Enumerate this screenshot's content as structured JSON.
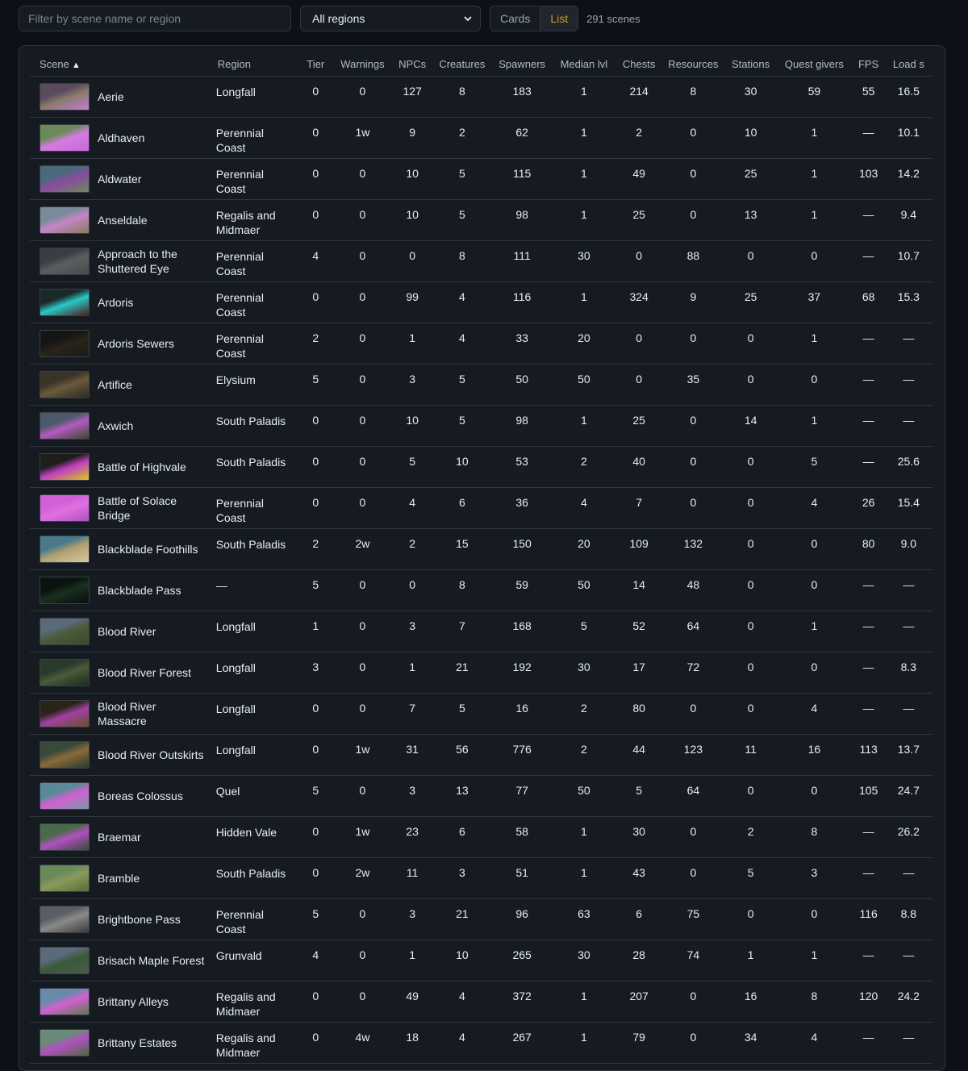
{
  "toolbar": {
    "filter_placeholder": "Filter by scene name or region",
    "region_select": "All regions",
    "view_cards": "Cards",
    "view_list": "List",
    "scene_count": "291 scenes"
  },
  "table": {
    "headers": {
      "scene": "Scene",
      "sort_arrow": "▲",
      "region": "Region",
      "tier": "Tier",
      "warnings": "Warnings",
      "npcs": "NPCs",
      "creatures": "Creatures",
      "spawners": "Spawners",
      "median_lvl": "Median lvl",
      "chests": "Chests",
      "resources": "Resources",
      "stations": "Stations",
      "quest_givers": "Quest givers",
      "fps": "FPS",
      "load": "Load s"
    },
    "rows": [
      {
        "name": "Aerie",
        "region": "Longfall",
        "tier": "0",
        "warnings": "0",
        "npcs": "127",
        "creatures": "8",
        "spawners": "183",
        "median": "1",
        "chests": "214",
        "resources": "8",
        "stations": "30",
        "quest": "59",
        "fps": "55",
        "load": "16.5",
        "thumb": [
          "#5a4a5e",
          "#8a7a6a",
          "#c77bd6"
        ]
      },
      {
        "name": "Aldhaven",
        "region": "Perennial Coast",
        "tier": "0",
        "warnings": "1w",
        "npcs": "9",
        "creatures": "2",
        "spawners": "62",
        "median": "1",
        "chests": "2",
        "resources": "0",
        "stations": "10",
        "quest": "1",
        "fps": "—",
        "load": "10.1",
        "thumb": [
          "#6a8a5a",
          "#d47ae0",
          "#c86ad8"
        ]
      },
      {
        "name": "Aldwater",
        "region": "Perennial Coast",
        "tier": "0",
        "warnings": "0",
        "npcs": "10",
        "creatures": "5",
        "spawners": "115",
        "median": "1",
        "chests": "49",
        "resources": "0",
        "stations": "25",
        "quest": "1",
        "fps": "103",
        "load": "14.2",
        "thumb": [
          "#4a6a7a",
          "#8a4aa0",
          "#6a8a5a"
        ]
      },
      {
        "name": "Anseldale",
        "region": "Regalis and Midmaer",
        "tier": "0",
        "warnings": "0",
        "npcs": "10",
        "creatures": "5",
        "spawners": "98",
        "median": "1",
        "chests": "25",
        "resources": "0",
        "stations": "13",
        "quest": "1",
        "fps": "—",
        "load": "9.4",
        "thumb": [
          "#7a8a9a",
          "#c486c8",
          "#8a7a5a"
        ]
      },
      {
        "name": "Approach to the Shuttered Eye",
        "region": "Perennial Coast",
        "tier": "4",
        "warnings": "0",
        "npcs": "0",
        "creatures": "8",
        "spawners": "111",
        "median": "30",
        "chests": "0",
        "resources": "88",
        "stations": "0",
        "quest": "0",
        "fps": "—",
        "load": "10.7",
        "thumb": [
          "#3a3e42",
          "#5a5e62",
          "#4a4a44"
        ]
      },
      {
        "name": "Ardoris",
        "region": "Perennial Coast",
        "tier": "0",
        "warnings": "0",
        "npcs": "99",
        "creatures": "4",
        "spawners": "116",
        "median": "1",
        "chests": "324",
        "resources": "9",
        "stations": "25",
        "quest": "37",
        "fps": "68",
        "load": "15.3",
        "thumb": [
          "#1a2a2a",
          "#2ac8c8",
          "#4a1a1a"
        ]
      },
      {
        "name": "Ardoris Sewers",
        "region": "Perennial Coast",
        "tier": "2",
        "warnings": "0",
        "npcs": "1",
        "creatures": "4",
        "spawners": "33",
        "median": "20",
        "chests": "0",
        "resources": "0",
        "stations": "0",
        "quest": "1",
        "fps": "—",
        "load": "—",
        "thumb": [
          "#151515",
          "#2a2418",
          "#1a1a1a"
        ]
      },
      {
        "name": "Artifice",
        "region": "Elysium",
        "tier": "5",
        "warnings": "0",
        "npcs": "3",
        "creatures": "5",
        "spawners": "50",
        "median": "50",
        "chests": "0",
        "resources": "35",
        "stations": "0",
        "quest": "0",
        "fps": "—",
        "load": "—",
        "thumb": [
          "#3a3428",
          "#6a5a3a",
          "#2a2a24"
        ]
      },
      {
        "name": "Axwich",
        "region": "South Paladis",
        "tier": "0",
        "warnings": "0",
        "npcs": "10",
        "creatures": "5",
        "spawners": "98",
        "median": "1",
        "chests": "25",
        "resources": "0",
        "stations": "14",
        "quest": "1",
        "fps": "—",
        "load": "—",
        "thumb": [
          "#4a5a6a",
          "#b45ac0",
          "#3a4a2a"
        ]
      },
      {
        "name": "Battle of Highvale",
        "region": "South Paladis",
        "tier": "0",
        "warnings": "0",
        "npcs": "5",
        "creatures": "10",
        "spawners": "53",
        "median": "2",
        "chests": "40",
        "resources": "0",
        "stations": "0",
        "quest": "5",
        "fps": "—",
        "load": "25.6",
        "thumb": [
          "#1e1e1a",
          "#c040c0",
          "#d8c820"
        ]
      },
      {
        "name": "Battle of Solace Bridge",
        "region": "Perennial Coast",
        "tier": "0",
        "warnings": "0",
        "npcs": "4",
        "creatures": "6",
        "spawners": "36",
        "median": "4",
        "chests": "7",
        "resources": "0",
        "stations": "0",
        "quest": "4",
        "fps": "26",
        "load": "15.4",
        "thumb": [
          "#d060d8",
          "#e070e0",
          "#b050c0"
        ]
      },
      {
        "name": "Blackblade Foothills",
        "region": "South Paladis",
        "tier": "2",
        "warnings": "2w",
        "npcs": "2",
        "creatures": "15",
        "spawners": "150",
        "median": "20",
        "chests": "109",
        "resources": "132",
        "stations": "0",
        "quest": "0",
        "fps": "80",
        "load": "9.0",
        "thumb": [
          "#4a7a8a",
          "#b0a070",
          "#d8c8a0"
        ]
      },
      {
        "name": "Blackblade Pass",
        "region": "—",
        "tier": "5",
        "warnings": "0",
        "npcs": "0",
        "creatures": "8",
        "spawners": "59",
        "median": "50",
        "chests": "14",
        "resources": "48",
        "stations": "0",
        "quest": "0",
        "fps": "—",
        "load": "—",
        "thumb": [
          "#0a140e",
          "#1a3020",
          "#0a0a0a"
        ]
      },
      {
        "name": "Blood River",
        "region": "Longfall",
        "tier": "1",
        "warnings": "0",
        "npcs": "3",
        "creatures": "7",
        "spawners": "168",
        "median": "5",
        "chests": "52",
        "resources": "64",
        "stations": "0",
        "quest": "1",
        "fps": "—",
        "load": "—",
        "thumb": [
          "#5a6a7a",
          "#4a5a3a",
          "#3a4a2a"
        ]
      },
      {
        "name": "Blood River Forest",
        "region": "Longfall",
        "tier": "3",
        "warnings": "0",
        "npcs": "1",
        "creatures": "21",
        "spawners": "192",
        "median": "30",
        "chests": "17",
        "resources": "72",
        "stations": "0",
        "quest": "0",
        "fps": "—",
        "load": "8.3",
        "thumb": [
          "#2a3a2a",
          "#4a5a3a",
          "#1a2a1a"
        ]
      },
      {
        "name": "Blood River Massacre",
        "region": "Longfall",
        "tier": "0",
        "warnings": "0",
        "npcs": "7",
        "creatures": "5",
        "spawners": "16",
        "median": "2",
        "chests": "80",
        "resources": "0",
        "stations": "0",
        "quest": "4",
        "fps": "—",
        "load": "—",
        "thumb": [
          "#2a2418",
          "#a040a0",
          "#6a5028"
        ]
      },
      {
        "name": "Blood River Outskirts",
        "region": "Longfall",
        "tier": "0",
        "warnings": "1w",
        "npcs": "31",
        "creatures": "56",
        "spawners": "776",
        "median": "2",
        "chests": "44",
        "resources": "123",
        "stations": "11",
        "quest": "16",
        "fps": "113",
        "load": "13.7",
        "thumb": [
          "#3a4a3a",
          "#8a6a3a",
          "#2a3a2a"
        ]
      },
      {
        "name": "Boreas Colossus",
        "region": "Quel",
        "tier": "5",
        "warnings": "0",
        "npcs": "3",
        "creatures": "13",
        "spawners": "77",
        "median": "50",
        "chests": "5",
        "resources": "64",
        "stations": "0",
        "quest": "0",
        "fps": "105",
        "load": "24.7",
        "thumb": [
          "#5a8a9a",
          "#d060d0",
          "#7a9aaa"
        ]
      },
      {
        "name": "Braemar",
        "region": "Hidden Vale",
        "tier": "0",
        "warnings": "1w",
        "npcs": "23",
        "creatures": "6",
        "spawners": "58",
        "median": "1",
        "chests": "30",
        "resources": "0",
        "stations": "2",
        "quest": "8",
        "fps": "—",
        "load": "26.2",
        "thumb": [
          "#4a6a4a",
          "#b050c0",
          "#3a4a3a"
        ]
      },
      {
        "name": "Bramble",
        "region": "South Paladis",
        "tier": "0",
        "warnings": "2w",
        "npcs": "11",
        "creatures": "3",
        "spawners": "51",
        "median": "1",
        "chests": "43",
        "resources": "0",
        "stations": "5",
        "quest": "3",
        "fps": "—",
        "load": "—",
        "thumb": [
          "#6a8a5a",
          "#8a9a5a",
          "#5a6a3a"
        ]
      },
      {
        "name": "Brightbone Pass",
        "region": "Perennial Coast",
        "tier": "5",
        "warnings": "0",
        "npcs": "3",
        "creatures": "21",
        "spawners": "96",
        "median": "63",
        "chests": "6",
        "resources": "75",
        "stations": "0",
        "quest": "0",
        "fps": "116",
        "load": "8.8",
        "thumb": [
          "#5a5e62",
          "#8a8a8a",
          "#3a3a3a"
        ]
      },
      {
        "name": "Brisach Maple Forest",
        "region": "Grunvald",
        "tier": "4",
        "warnings": "0",
        "npcs": "1",
        "creatures": "10",
        "spawners": "265",
        "median": "30",
        "chests": "28",
        "resources": "74",
        "stations": "1",
        "quest": "1",
        "fps": "—",
        "load": "—",
        "thumb": [
          "#5a6a7a",
          "#3a5a3a",
          "#4a5a4a"
        ]
      },
      {
        "name": "Brittany Alleys",
        "region": "Regalis and Midmaer",
        "tier": "0",
        "warnings": "0",
        "npcs": "49",
        "creatures": "4",
        "spawners": "372",
        "median": "1",
        "chests": "207",
        "resources": "0",
        "stations": "16",
        "quest": "8",
        "fps": "120",
        "load": "24.2",
        "thumb": [
          "#6a8aaa",
          "#d060d0",
          "#5a7a4a"
        ]
      },
      {
        "name": "Brittany Estates",
        "region": "Regalis and Midmaer",
        "tier": "0",
        "warnings": "4w",
        "npcs": "18",
        "creatures": "4",
        "spawners": "267",
        "median": "1",
        "chests": "79",
        "resources": "0",
        "stations": "34",
        "quest": "4",
        "fps": "—",
        "load": "—",
        "thumb": [
          "#6a8a7a",
          "#b050c0",
          "#4a6a3a"
        ]
      }
    ]
  }
}
